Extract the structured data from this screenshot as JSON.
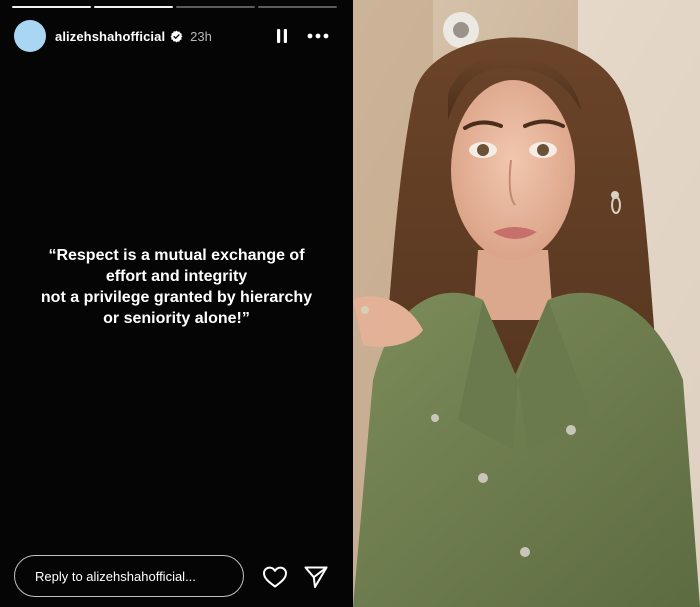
{
  "story": {
    "progress_segments": [
      {
        "state": "done"
      },
      {
        "state": "done"
      },
      {
        "state": "active"
      },
      {
        "state": "pending"
      }
    ],
    "header": {
      "username": "alizehshahofficial",
      "timestamp": "23h",
      "verified_icon": "verified-badge-icon",
      "pause_icon": "pause-icon",
      "more_icon": "more-icon"
    },
    "quote": "“Respect is a mutual exchange of\neffort and integrity\nnot a privilege granted by hierarchy\nor seniority alone!”",
    "footer": {
      "reply_placeholder": "Reply to alizehshahofficial...",
      "like_icon": "heart-icon",
      "share_icon": "send-icon"
    }
  },
  "photo": {
    "description_icon": "portrait-photo",
    "colors": {
      "wall": "#c9b49a",
      "hair": "#5a3a22",
      "skin": "#e8b89e",
      "jacket": "#6f7f4f",
      "lips": "#c7706b"
    }
  },
  "colors": {
    "story_bg": "#050505",
    "text": "#ffffff",
    "muted": "#b9b9b9",
    "avatar": "#a9d6f3"
  }
}
